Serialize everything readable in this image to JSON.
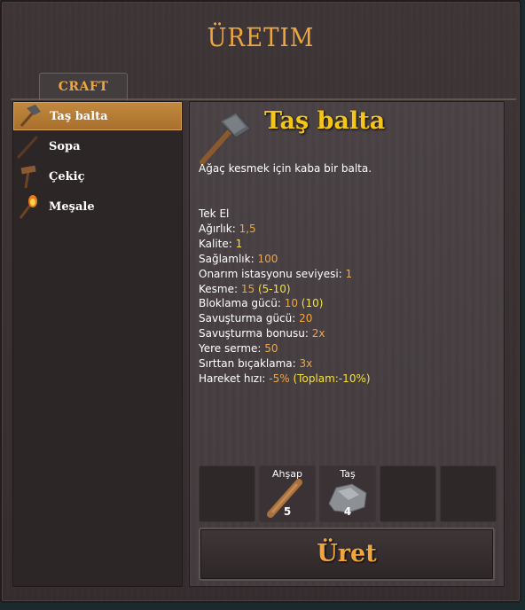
{
  "window": {
    "title": "ÜRETIM"
  },
  "tabs": [
    {
      "label": "CRAFT"
    }
  ],
  "recipes": [
    {
      "label": "Taş balta",
      "icon": "stone-axe-icon",
      "selected": true
    },
    {
      "label": "Sopa",
      "icon": "club-icon",
      "selected": false
    },
    {
      "label": "Çekiç",
      "icon": "hammer-icon",
      "selected": false
    },
    {
      "label": "Meşale",
      "icon": "torch-icon",
      "selected": false
    }
  ],
  "detail": {
    "name": "Taş balta",
    "description": "Ağaç kesmek için kaba bir balta.",
    "handed": "Tek El",
    "stats": [
      {
        "label": "Ağırlık: ",
        "value": "1,5",
        "extra": ""
      },
      {
        "label": "Kalite: ",
        "value": "1",
        "extra": ""
      },
      {
        "label": "Sağlamlık: ",
        "value": "100",
        "extra": ""
      },
      {
        "label": "Onarım istasyonu seviyesi: ",
        "value": "1",
        "extra": ""
      },
      {
        "label": "Kesme: ",
        "value": "15",
        "extra": "(5-10)"
      },
      {
        "label": "Bloklama gücü: ",
        "value": "10",
        "extra": "(10)"
      },
      {
        "label": "Savuşturma gücü: ",
        "value": "20",
        "extra": ""
      },
      {
        "label": "Savuşturma bonusu: ",
        "value": "2x",
        "extra": ""
      },
      {
        "label": "Yere serme: ",
        "value": "50",
        "extra": ""
      },
      {
        "label": "Sırttan bıçaklama: ",
        "value": "3x",
        "extra": ""
      },
      {
        "label": "Hareket hızı: ",
        "value": "-5%",
        "extra": "(Toplam:-10%)"
      }
    ]
  },
  "requirements": [
    {
      "name": "",
      "count": ""
    },
    {
      "name": "Ahşap",
      "count": "5",
      "icon": "wood-icon"
    },
    {
      "name": "Taş",
      "count": "4",
      "icon": "stone-icon"
    },
    {
      "name": "",
      "count": ""
    },
    {
      "name": "",
      "count": ""
    }
  ],
  "craft_button": {
    "label": "Üret"
  },
  "colors": {
    "accent": "#f0a63e",
    "item_name": "#f5c518",
    "selected": "#b87a33"
  }
}
